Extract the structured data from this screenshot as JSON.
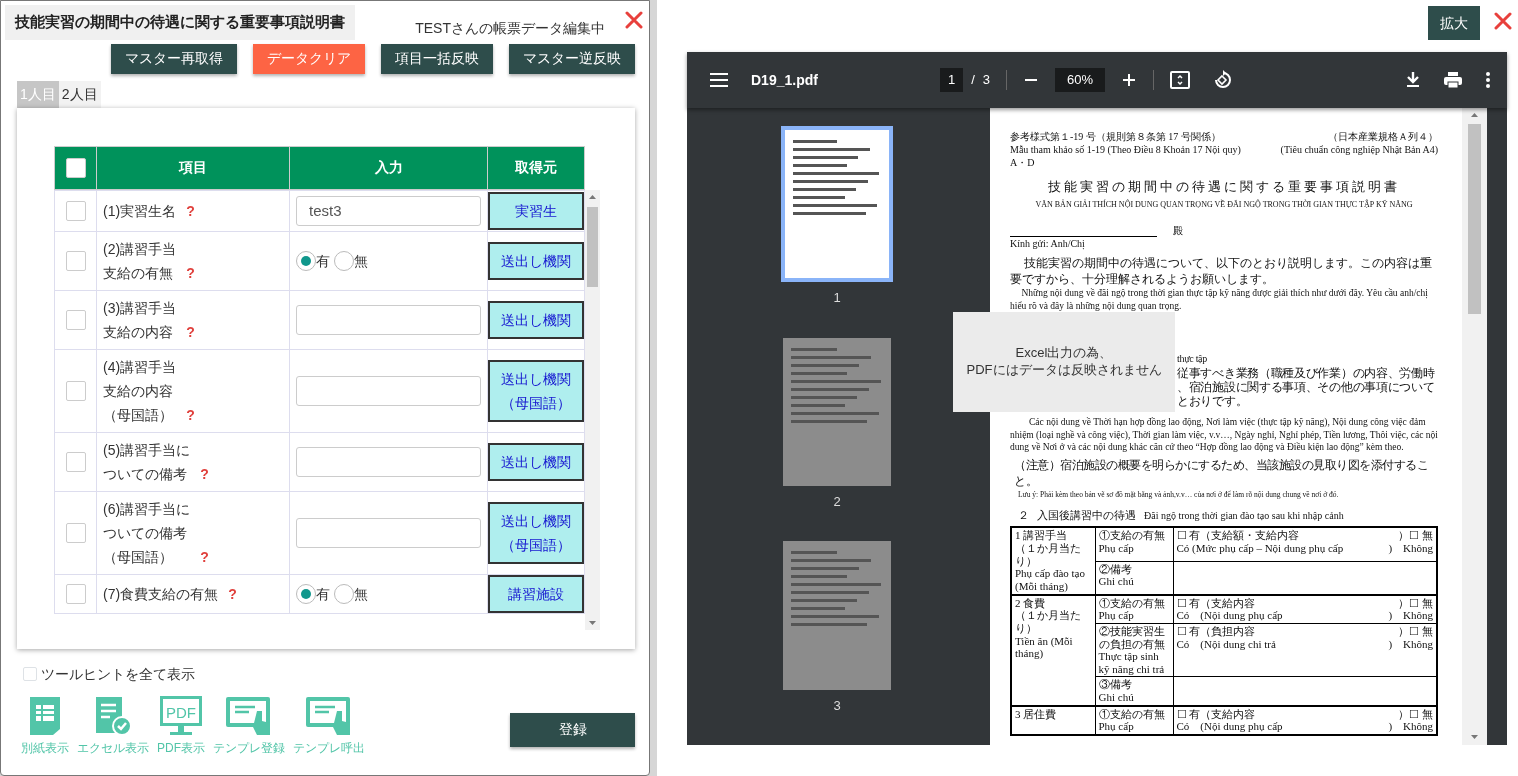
{
  "form": {
    "title": "技能実習の期間中の待遇に関する重要事項説明書",
    "status": "TESTさんの帳票データ編集中",
    "actions": [
      {
        "label": "マスター再取得",
        "kind": "default"
      },
      {
        "label": "データクリア",
        "kind": "danger"
      },
      {
        "label": "項目一括反映",
        "kind": "default"
      },
      {
        "label": "マスター逆反映",
        "kind": "default"
      }
    ],
    "tabs": [
      {
        "label": "1人目",
        "selected": true
      },
      {
        "label": "2人目",
        "selected": false
      }
    ],
    "table": {
      "columns": [
        "項目",
        "入力",
        "取得元"
      ],
      "all_checked": false,
      "rows": [
        {
          "checked": false,
          "item_lines": [
            "(1)実習生名"
          ],
          "help": "?",
          "input": {
            "kind": "text",
            "value": "test3"
          },
          "source_lines": [
            "実習生"
          ]
        },
        {
          "checked": false,
          "item_lines": [
            "(2)講習手当",
            "支給の有無"
          ],
          "help": "?",
          "input": {
            "kind": "radio",
            "options": [
              {
                "label": "有",
                "selected": true
              },
              {
                "label": "無",
                "selected": false
              }
            ]
          },
          "source_lines": [
            "送出し機関"
          ]
        },
        {
          "checked": false,
          "item_lines": [
            "(3)講習手当",
            "支給の内容"
          ],
          "help": "?",
          "input": {
            "kind": "text"
          },
          "source_lines": [
            "送出し機関"
          ]
        },
        {
          "checked": false,
          "item_lines": [
            "(4)講習手当",
            "支給の内容",
            "（母国語）"
          ],
          "help": "?",
          "input": {
            "kind": "text"
          },
          "source_lines": [
            "送出し機関",
            "（母国語）"
          ]
        },
        {
          "checked": false,
          "item_lines": [
            "(5)講習手当に",
            "ついての備考"
          ],
          "help": "?",
          "input": {
            "kind": "text"
          },
          "source_lines": [
            "送出し機関"
          ]
        },
        {
          "checked": false,
          "item_lines": [
            "(6)講習手当に",
            "ついての備考",
            "（母国語）"
          ],
          "help": "?",
          "input": {
            "kind": "text"
          },
          "source_lines": [
            "送出し機関",
            "（母国語）"
          ]
        },
        {
          "checked": false,
          "item_lines": [
            "(7)食費支給の有無"
          ],
          "help": "?",
          "input": {
            "kind": "radio",
            "options": [
              {
                "label": "有",
                "selected": true
              },
              {
                "label": "無",
                "selected": false
              }
            ]
          },
          "source_lines": [
            "講習施設"
          ]
        }
      ]
    },
    "show_all_tooltips": {
      "label": "ツールヒントを全て表示",
      "checked": false
    },
    "tools": [
      {
        "label": "別紙表示",
        "kind": "sheet"
      },
      {
        "label": "エクセル表示",
        "kind": "excel"
      },
      {
        "label": "PDF表示",
        "kind": "pdf",
        "icon_text": "PDF"
      },
      {
        "label": "テンプレ登録",
        "kind": "template"
      },
      {
        "label": "テンプレ呼出",
        "kind": "template"
      }
    ],
    "submit": "登録"
  },
  "preview": {
    "expand": "拡大",
    "viewer": {
      "file_name": "D19_1.pdf",
      "page": "1",
      "page_separator": "/",
      "page_count": "3",
      "zoom": "60%",
      "thumbnails": [
        {
          "label": "1",
          "selected": true
        },
        {
          "label": "2",
          "selected": false
        },
        {
          "label": "3",
          "selected": false
        }
      ],
      "notice_lines": [
        "Excel出力の為、",
        "PDFにはデータは反映されません"
      ],
      "document": {
        "header_left": [
          "参考様式第１-19 号（規則第８条第 17 号関係）",
          "Mẫu tham khảo số 1-19 (Theo Điều 8 Khoản 17 Nội quy)",
          "A・D"
        ],
        "header_right": [
          "（日本産業規格Ａ列４）",
          "(Tiêu chuẩn công nghiệp Nhật Bản A4)"
        ],
        "title": "技能実習の期間中の待遇に関する重要事項説明書",
        "subtitle": "VĂN BẢN GIẢI THÍCH NỘI DUNG QUAN TRỌNG VỀ ĐÃI NGỘ TRONG THỜI GIAN THỰC TẬP KỸ NĂNG",
        "honorific": "殿",
        "greeting": "Kính gửi: Anh/Chị",
        "intro_paragraphs": [
          "技能実習の期間中の待遇について、以下のとおり説明します。この内容は重要ですから、十分理解されるようお願いします。",
          "Những nội dung về đãi ngộ trong thời gian thực tập kỹ năng được giải thích như dưới đây. Yêu cầu anh/chị hiểu rõ và đây là những nội dung quan trọng."
        ],
        "covered_fragments": [
          "thực tập",
          "従事すべき業務（職種及び作業）の内容、労働時",
          "、宿泊施設に関する事項、その他の事項について",
          "とおりです。"
        ],
        "paragraph": "Các nội dung về Thời hạn hợp đồng lao động, Nơi làm việc (thực tập kỹ năng), Nội dung công việc đảm nhiệm (loại nghề và công việc), Thời gian làm việc, v.v…, Ngày nghỉ, Nghỉ phép, Tiền lương, Thôi việc, các nội dung về Nơi ở và các nội dung khác căn cứ theo “Hợp đồng lao động và Điều kiện lao động” kèm theo.",
        "notes": [
          "（注意）宿泊施設の概要を明らかにするため、当該施設の見取り図を添付すること。",
          "Lưu ý: Phải kèm theo bản vẽ sơ đồ mặt bằng và ảnh,v.v… của nơi ở để làm rõ nội dung chung về nơi ở đó."
        ],
        "section_heading": {
          "number": "２",
          "ja": "入国後講習中の待遇",
          "vi": "Đãi ngộ trong thời gian đào tạo sau khi nhập cảnh"
        },
        "table": [
          {
            "head_lines": [
              "1 講習手当",
              "（１か月当たり）",
              "Phụ cấp đào tạo",
              "(Mỗi tháng)"
            ],
            "items": [
              {
                "label_lines": [
                  "①支給の有無",
                  "Phụ cấp"
                ],
                "lines": [
                  {
                    "left": "☐ 有（支給額・支給内容",
                    "right": "）☐ 無"
                  },
                  {
                    "left": "Có (Mức phụ cấp – Nội dung phụ cấp",
                    "right": ")　Không"
                  }
                ]
              },
              {
                "label_lines": [
                  "②備考",
                  "Ghi chú"
                ]
              }
            ]
          },
          {
            "head_lines": [
              "2 食費",
              "（１か月当たり）",
              "Tiền ăn (Mỗi",
              "tháng)"
            ],
            "items": [
              {
                "label_lines": [
                  "①支給の有無",
                  "Phụ cấp"
                ],
                "lines": [
                  {
                    "left": "☐ 有（支給内容",
                    "right": "）☐ 無"
                  },
                  {
                    "left": "Có　(Nội dung phụ cấp",
                    "right": ")　Không"
                  }
                ]
              },
              {
                "label_lines": [
                  "②技能実習生",
                  "の負担の有無",
                  "Thực tập sinh",
                  "kỹ năng chi trả"
                ],
                "lines": [
                  {
                    "left": "☐ 有（負担内容",
                    "right": "）☐ 無"
                  },
                  {
                    "left": "Có　(Nội dung chi trả",
                    "right": ")　Không"
                  }
                ]
              },
              {
                "label_lines": [
                  "③備考",
                  "Ghi chú"
                ]
              }
            ]
          },
          {
            "head_lines": [
              "3 居住費"
            ],
            "items": [
              {
                "label_lines": [
                  "①支給の有無",
                  "Phụ cấp"
                ],
                "lines": [
                  {
                    "left": "☐ 有（支給内容",
                    "right": "）☐ 無"
                  },
                  {
                    "left": "Có　(Nội dung phụ cấp",
                    "right": ")　Không"
                  }
                ]
              }
            ]
          }
        ]
      }
    }
  }
}
